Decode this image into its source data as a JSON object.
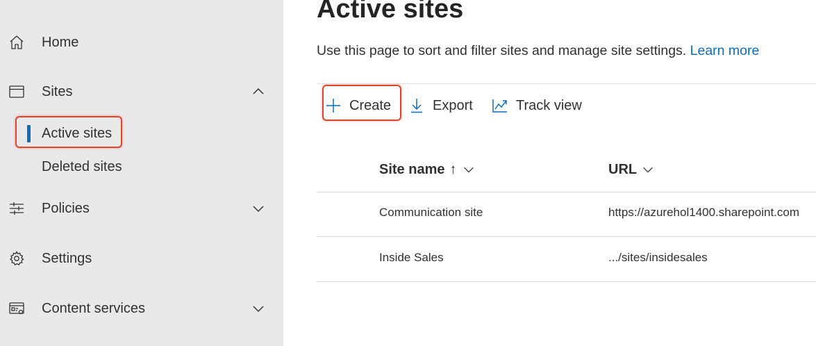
{
  "sidebar": {
    "items": [
      {
        "label": "Home",
        "icon": "home-icon"
      },
      {
        "label": "Sites",
        "icon": "browser-window-icon",
        "expanded": true
      },
      {
        "label": "Policies",
        "icon": "sliders-icon",
        "expanded": false
      },
      {
        "label": "Settings",
        "icon": "gear-icon"
      },
      {
        "label": "Content services",
        "icon": "content-services-icon",
        "expanded": false
      }
    ],
    "sites_sub": [
      {
        "label": "Active sites",
        "selected": true
      },
      {
        "label": "Deleted sites",
        "selected": false
      }
    ]
  },
  "main": {
    "title": "Active sites",
    "description": "Use this page to sort and filter sites and manage site settings.",
    "learn_more": "Learn more",
    "commands": {
      "create": "Create",
      "export": "Export",
      "track_view": "Track view"
    },
    "table": {
      "columns": [
        "Site name",
        "URL"
      ],
      "sort_indicator": "↑",
      "rows": [
        {
          "name": "Communication site",
          "url": "https://azurehol1400.sharepoint.com"
        },
        {
          "name": "Inside Sales",
          "url": ".../sites/insidesales"
        }
      ]
    }
  },
  "colors": {
    "accent": "#0f6cbd",
    "highlight": "#e0452a",
    "sidebar_bg": "#e9e9e9"
  }
}
